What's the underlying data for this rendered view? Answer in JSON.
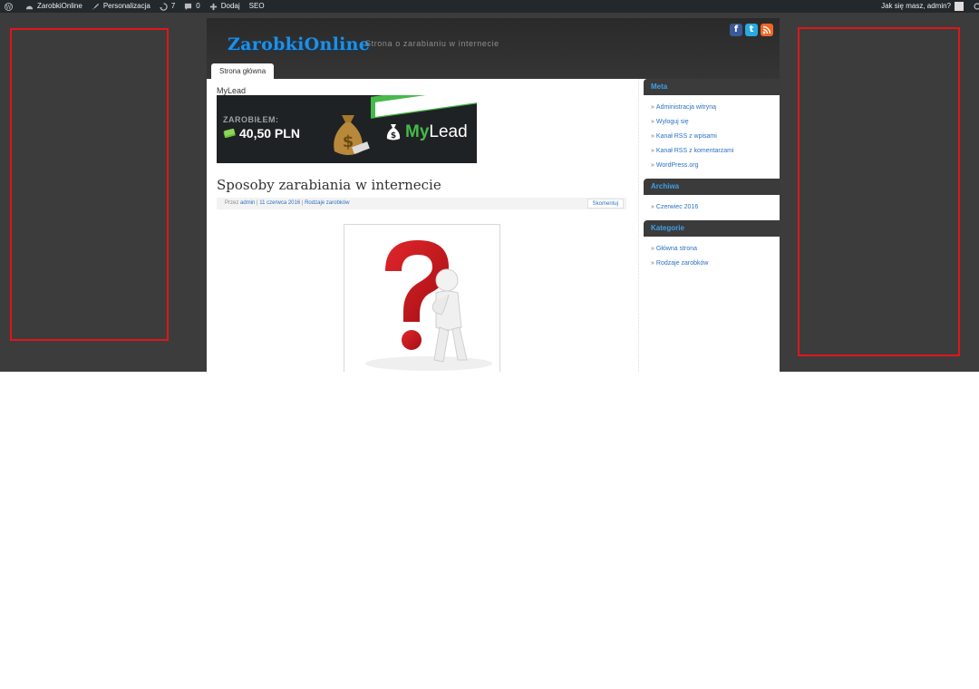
{
  "adminbar": {
    "site_name": "ZarobkiOnline",
    "customize": "Personalizacja",
    "updates": "7",
    "comments": "0",
    "add_new": "Dodaj",
    "seo": "SEO",
    "greeting": "Jak się masz, admin?"
  },
  "header": {
    "logo": "ZarobkiOnline",
    "tagline": "Strona o zarabianiu w internecie",
    "social": [
      "facebook-icon",
      "twitter-icon",
      "rss-icon"
    ]
  },
  "nav": {
    "tabs": [
      {
        "label": "Strona główna"
      }
    ]
  },
  "content": {
    "widget_title": "MyLead",
    "banner": {
      "earned_label": "ZAROBIŁEM:",
      "amount": "40,50 PLN",
      "brand_prefix": "My",
      "brand_suffix": "Lead"
    },
    "post": {
      "title": "Sposoby zarabiania w internecie",
      "by": "Przez",
      "author": "admin",
      "date": "11 czerwca 2016",
      "category": "Rodzaje zarobków",
      "comment_button": "Skomentuj"
    }
  },
  "sidebar": {
    "widgets": [
      {
        "title": "Meta",
        "items": [
          "Administracja witryną",
          "Wyloguj się",
          "Kanał RSS z wpisami",
          "Kanał RSS z komentarzami",
          "WordPress.org"
        ]
      },
      {
        "title": "Archiwa",
        "items": [
          "Czerwiec 2016"
        ]
      },
      {
        "title": "Kategorie",
        "items": [
          "Główna strona",
          "Rodzaje zarobków"
        ]
      }
    ]
  },
  "colors": {
    "accent": "#2b72c2",
    "ad_border": "#e0151b",
    "brand_green": "#46b94a",
    "logo_blue": "#1e90e8"
  }
}
